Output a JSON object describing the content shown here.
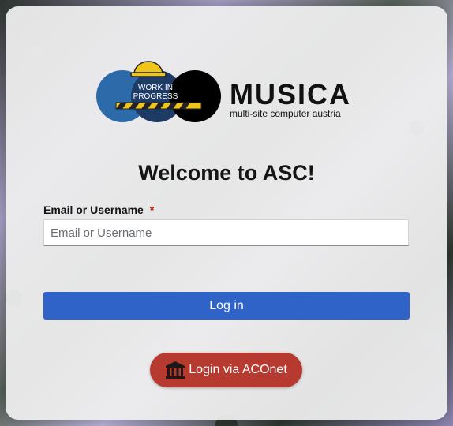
{
  "logo": {
    "name": "MUSICA",
    "tagline": "multi-site computer austria",
    "badge_line1": "WORK IN",
    "badge_line2": "PROGRESS"
  },
  "heading": "Welcome to ASC!",
  "form": {
    "username_label": "Email or Username",
    "required_marker": "*",
    "username_placeholder": "Email or Username",
    "username_value": "",
    "login_button": "Log in"
  },
  "identity_provider": {
    "label": "Login via ACOnet",
    "icon": "institution-icon"
  },
  "colors": {
    "primary": "#2f63c8",
    "idp": "#b73a30",
    "required": "#c9190b"
  }
}
